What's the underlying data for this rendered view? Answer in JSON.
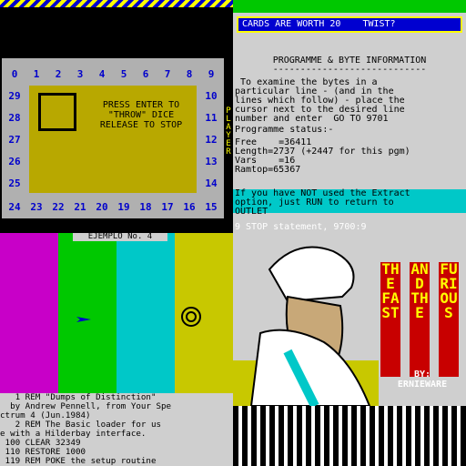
{
  "board_game": {
    "top_numbers": [
      "0",
      "1",
      "2",
      "3",
      "4",
      "5",
      "6",
      "7",
      "8",
      "9"
    ],
    "bottom_numbers": [
      "24",
      "23",
      "22",
      "21",
      "20",
      "19",
      "18",
      "17",
      "16",
      "15"
    ],
    "left_numbers": [
      "29",
      "28",
      "27",
      "26",
      "25"
    ],
    "right_numbers": [
      "10",
      "11",
      "12",
      "13",
      "14"
    ],
    "press_text": "PRESS ENTER TO",
    "throw_text": "\"THROW\" DICE",
    "release_text": "RELEASE TO STOP",
    "side_label": "PLAYER",
    "colors": {
      "board": "#b0b0b0",
      "inner": "#b8a800",
      "number": "#0000cc"
    }
  },
  "info_screen": {
    "banner": "CARDS ARE WORTH 20    TWIST?",
    "heading": "PROGRAMME & BYTE INFORMATION",
    "rule": "----------------------------",
    "instructions": [
      " To examine the bytes in a",
      "particular line - (and in the",
      "lines which follow) - place the",
      "cursor next to the desired line",
      "number and enter  GO TO 9701"
    ],
    "status_label": "Programme status:-",
    "stats": [
      "Free    =36411",
      "Length=2737 (+2447 for this pgm)",
      "Vars    =16",
      "Ramtop=65367"
    ],
    "notice": [
      "If you have NOT used the Extract",
      "option, just RUN to return to",
      "OUTLET"
    ],
    "stop_line": "9 STOP statement, 9700:9"
  },
  "listing_screen": {
    "title": "EJEMPLO No. 4",
    "listing": [
      "   1 REM \"Dumps of Distinction\"",
      "  by Andrew Pennell, from Your Spe",
      "ctrum 4 (Jun.1984)",
      "   2 REM The Basic loader for us",
      "e with a Hilderbay interface.",
      " 100 CLEAR 32349",
      " 110 RESTORE 1000",
      " 119 REM POKE the setup routine"
    ],
    "band_colors": [
      "#c800c8",
      "#00c800",
      "#00c8c8",
      "#c8c800"
    ]
  },
  "game_title": {
    "title_words": [
      "THE FAST",
      "AND THE",
      "FURIOUS"
    ],
    "by_label": "BY:",
    "author": "ERNIEWARE"
  }
}
